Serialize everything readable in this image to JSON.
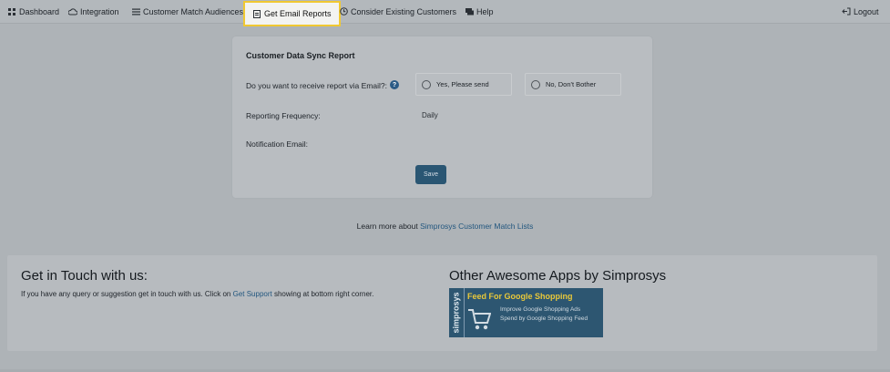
{
  "nav": {
    "items": [
      {
        "label": "Dashboard",
        "icon": "grid-icon"
      },
      {
        "label": "Integration",
        "icon": "cloud-icon"
      },
      {
        "label": "Customer Match Audiences",
        "icon": "list-icon"
      },
      {
        "label": "Get Email Reports",
        "icon": "report-icon",
        "active": true
      },
      {
        "label": "Consider Existing Customers",
        "icon": "clock-icon"
      },
      {
        "label": "Help",
        "icon": "chat-icon"
      }
    ],
    "logout": "Logout"
  },
  "report": {
    "title": "Customer Data Sync Report",
    "question": "Do you want to receive report via Email?:",
    "help_glyph": "?",
    "option_yes": "Yes, Please send",
    "option_no": "No, Don't Bother",
    "frequency_label": "Reporting Frequency:",
    "frequency_value": "Daily",
    "email_label": "Notification Email:",
    "save_label": "Save"
  },
  "learn_more": {
    "prefix": "Learn more about",
    "link": "Simprosys Customer Match Lists"
  },
  "footer": {
    "contact_title": "Get in Touch with us:",
    "contact_text_prefix": "If you have any query or suggestion get in touch with us. Click on",
    "contact_link": "Get Support",
    "contact_text_suffix": "showing at bottom right corner.",
    "apps_title": "Other Awesome Apps by Simprosys",
    "app": {
      "brand": "simprosys",
      "title": "Feed For Google Shopping",
      "description": "Improve Google Shopping Ads Spend by Google Shopping Feed"
    }
  },
  "colors": {
    "active_border": "#f0c832",
    "link": "#23577f",
    "button": "#2a5673"
  }
}
